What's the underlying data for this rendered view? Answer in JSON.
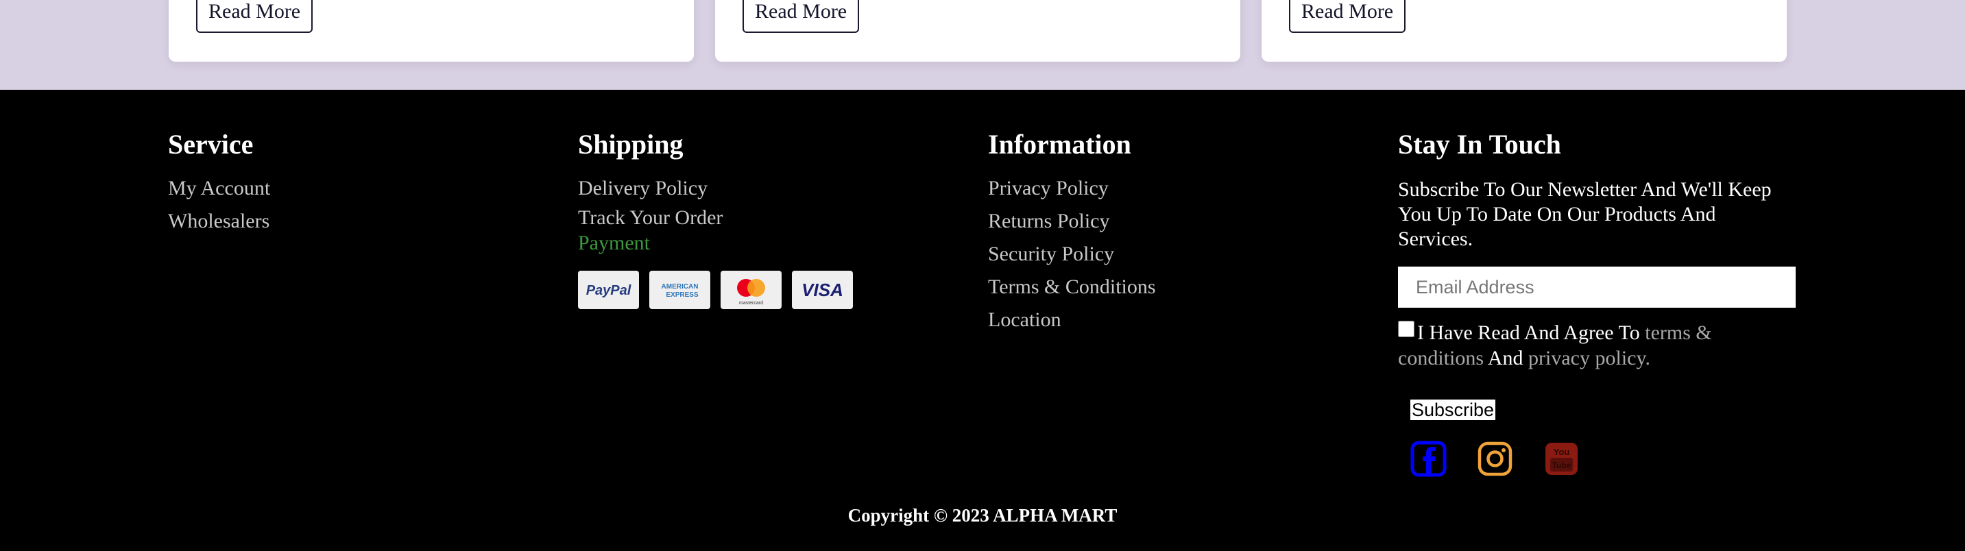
{
  "cards": [
    {
      "read_more_label": "Read More"
    },
    {
      "read_more_label": "Read More"
    },
    {
      "read_more_label": "Read More"
    }
  ],
  "footer": {
    "service": {
      "title": "Service",
      "links": [
        "My Account",
        "Wholesalers"
      ]
    },
    "shipping": {
      "title": "Shipping",
      "links": [
        "Delivery Policy",
        "Track Your Order",
        "Payment"
      ],
      "payment_methods": [
        "paypal-icon",
        "american-express-icon",
        "mastercard-icon",
        "visa-icon"
      ],
      "payment_labels": {
        "paypal": "PayPal",
        "amex_line1": "AMERICAN",
        "amex_line2": "EXPRESS",
        "mastercard": "mastercard",
        "visa": "VISA"
      }
    },
    "information": {
      "title": "Information",
      "links": [
        "Privacy Policy",
        "Returns Policy",
        "Security Policy",
        "Terms & Conditions",
        "Location"
      ]
    },
    "stay_in_touch": {
      "title": "Stay In Touch",
      "description": "Subscribe To Our Newsletter And We'll Keep You Up To Date On Our Products And Services.",
      "email_placeholder": "Email Address",
      "agree_text": "I Have Read And Agree To",
      "terms_link": "terms & conditions",
      "and_text": "And",
      "privacy_link": "privacy policy.",
      "subscribe_label": "Subscribe",
      "social": [
        "facebook-icon",
        "instagram-icon",
        "youtube-icon"
      ]
    },
    "copyright": "Copyright © 2023 ALPHA MART"
  },
  "colors": {
    "page_bg": "#d8d0e3",
    "footer_bg": "#000000",
    "link": "#c9c9c9",
    "accent_link": "#3c9a3c",
    "facebook": "#0000ff",
    "instagram": "#f0a33a",
    "youtube": "#8b1a10"
  }
}
